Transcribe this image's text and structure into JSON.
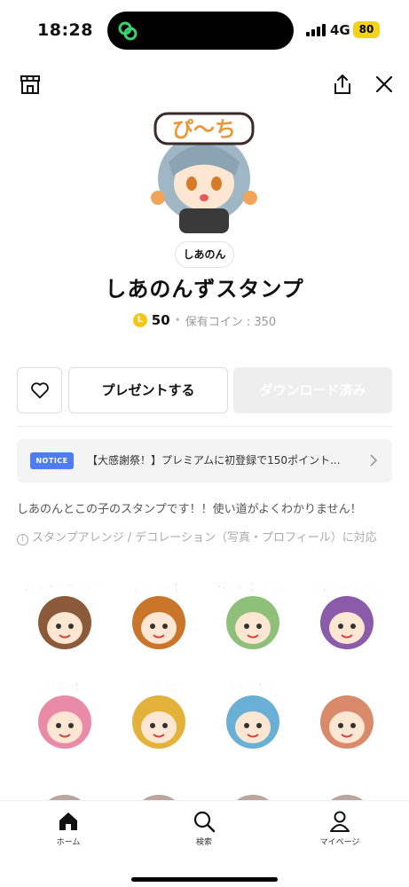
{
  "status_bar": {
    "time": "18:28",
    "network": "4G",
    "battery": "80"
  },
  "toolbar": {
    "left_icon": "shop-icon",
    "share_icon": "share-icon",
    "close_icon": "close-icon"
  },
  "product": {
    "author": "しあのん",
    "title": "しあのんずスタンプ",
    "coin_symbol": "L",
    "price": "50",
    "owned_coins": "保有コイン : 350"
  },
  "actions": {
    "gift_label": "プレゼントする",
    "download_label": "ダウンロード済み"
  },
  "notice": {
    "badge": "NOTICE",
    "text": "【大感謝祭！】プレミアムに初登録で150ポイント..."
  },
  "description": "しあのんとこの子のスタンプです！！使い道がよくわかりません！",
  "compatibility": "スタンプアレンジ / デコレーション（写真・プロフィール）に対応",
  "stickers": [
    {
      "caption": "はっぴ〜 うれし〜",
      "color": "#8a5a3a"
    },
    {
      "caption": "はぁぁ〜！",
      "color": "#c9762a"
    },
    {
      "caption": "神様なんて いないよ",
      "color": "#8fc07a"
    },
    {
      "caption": "死にたくなった",
      "color": "#8b5aa8"
    },
    {
      "caption": "がおっ！",
      "color": "#e98aa7"
    },
    {
      "caption": "兵器なの？",
      "color": "#e2b23a"
    },
    {
      "caption": "泣くぞ！？",
      "color": "#6ab0d6"
    },
    {
      "caption": "",
      "color": "#d98a6a"
    }
  ],
  "bottom_nav": {
    "home": "ホーム",
    "search": "検索",
    "mypage": "マイページ"
  },
  "colors": {
    "coin": "#f5c518",
    "notice_badge": "#4f7cf0",
    "battery": "#f2d21b",
    "island_icon": "#3bd16f"
  }
}
